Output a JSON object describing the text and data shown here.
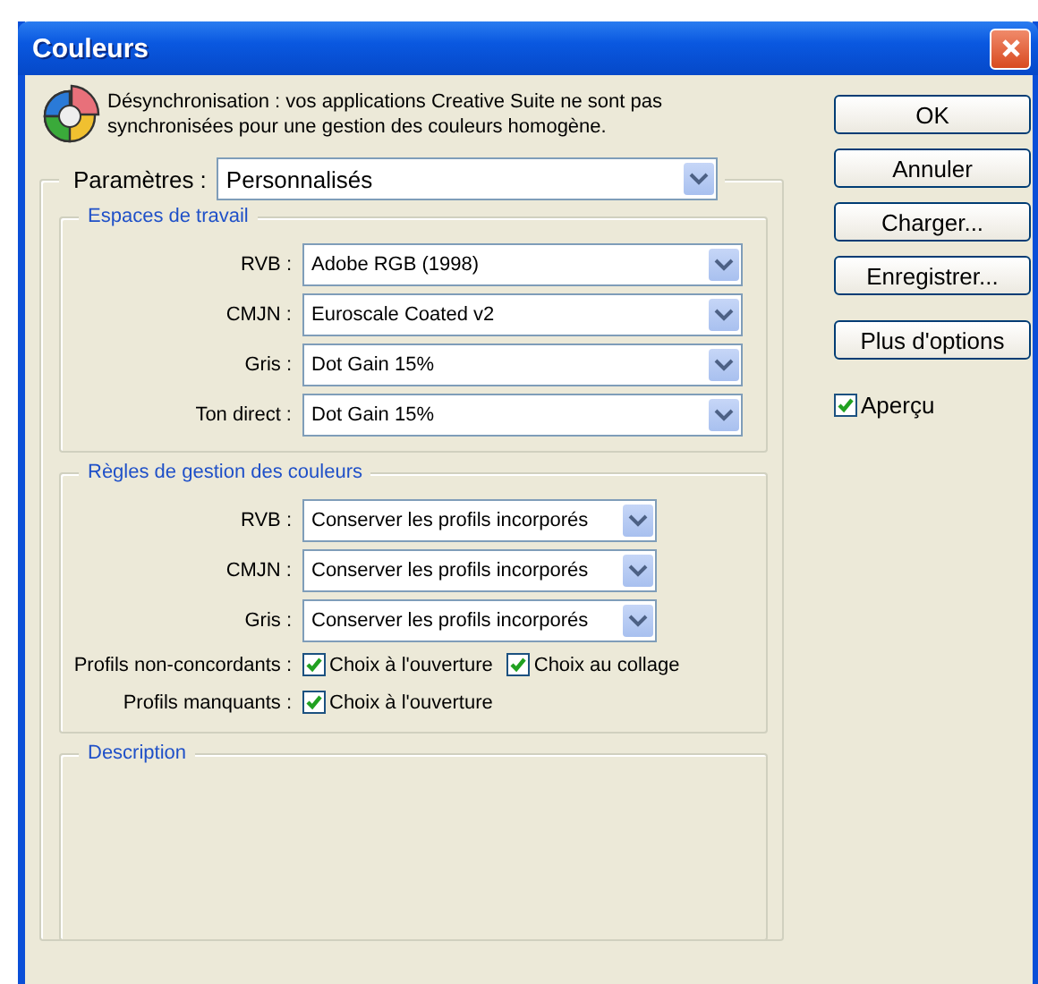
{
  "window": {
    "title": "Couleurs"
  },
  "notice": {
    "text": "Désynchronisation : vos applications Creative Suite ne sont pas synchronisées pour une gestion des couleurs homogène."
  },
  "settings": {
    "label": "Paramètres :",
    "value": "Personnalisés"
  },
  "sections": [
    {
      "title": "Espaces de travail",
      "rows": [
        {
          "kind": "select",
          "label": "RVB :",
          "value": "Adobe RGB (1998)"
        },
        {
          "kind": "select",
          "label": "CMJN :",
          "value": "Euroscale Coated v2"
        },
        {
          "kind": "select",
          "label": "Gris :",
          "value": "Dot Gain 15%"
        },
        {
          "kind": "select",
          "label": "Ton direct :",
          "value": "Dot Gain 15%"
        }
      ]
    },
    {
      "title": "Règles de gestion des couleurs",
      "rows": [
        {
          "kind": "select",
          "label": "RVB :",
          "value": "Conserver les profils incorporés"
        },
        {
          "kind": "select",
          "label": "CMJN :",
          "value": "Conserver les profils incorporés"
        },
        {
          "kind": "select",
          "label": "Gris :",
          "value": "Conserver les profils incorporés"
        },
        {
          "kind": "checks",
          "label": "Profils non-concordants :",
          "options": [
            {
              "label": "Choix à l'ouverture",
              "checked": true
            },
            {
              "label": "Choix au collage",
              "checked": true
            }
          ]
        },
        {
          "kind": "checks",
          "label": "Profils manquants :",
          "options": [
            {
              "label": "Choix à l'ouverture",
              "checked": true
            }
          ]
        }
      ]
    },
    {
      "title": "Description"
    }
  ],
  "buttons": [
    {
      "label": "OK"
    },
    {
      "label": "Annuler"
    },
    {
      "label": "Charger..."
    },
    {
      "label": "Enregistrer..."
    },
    {
      "label": "Plus d'options"
    }
  ],
  "preview": {
    "label": "Aperçu",
    "checked": true
  }
}
